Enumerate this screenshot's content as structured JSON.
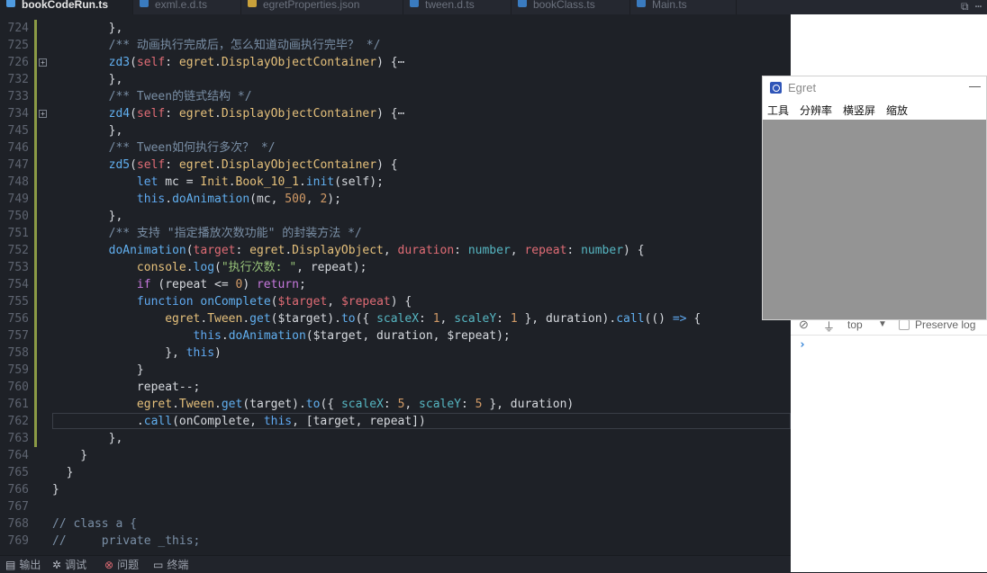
{
  "tabs": [
    {
      "label": "bookCodeRun.ts",
      "active": true,
      "kind": "ts"
    },
    {
      "label": "exml.e.d.ts",
      "active": false,
      "kind": "ts"
    },
    {
      "label": "egretProperties.json",
      "active": false,
      "kind": "json"
    },
    {
      "label": "tween.d.ts",
      "active": false,
      "kind": "ts"
    },
    {
      "label": "bookClass.ts",
      "active": false,
      "kind": "ts"
    },
    {
      "label": "Main.ts",
      "active": false,
      "kind": "ts"
    }
  ],
  "tab_tools": "⧉ ⋯",
  "code_lines": [
    {
      "n": "724",
      "fold": false,
      "tokens": [
        [
          "        },",
          "p"
        ]
      ]
    },
    {
      "n": "725",
      "fold": false,
      "tokens": [
        [
          "        ",
          "p"
        ],
        [
          "/** 动画执行完成后，怎么知道动画执行完毕？ */",
          "cm"
        ]
      ]
    },
    {
      "n": "726",
      "fold": true,
      "tokens": [
        [
          "        ",
          "p"
        ],
        [
          "zd3",
          "fn"
        ],
        [
          "(",
          "p"
        ],
        [
          "self",
          "prm"
        ],
        [
          ": ",
          "p"
        ],
        [
          "egret",
          "ty"
        ],
        [
          ".",
          "p"
        ],
        [
          "DisplayObjectContainer",
          "ty"
        ],
        [
          ") {⋯",
          "p"
        ]
      ]
    },
    {
      "n": "732",
      "fold": false,
      "tokens": [
        [
          "        },",
          "p"
        ]
      ]
    },
    {
      "n": "733",
      "fold": false,
      "tokens": [
        [
          "        ",
          "p"
        ],
        [
          "/** Tween的链式结构 */",
          "cm"
        ]
      ]
    },
    {
      "n": "734",
      "fold": true,
      "tokens": [
        [
          "        ",
          "p"
        ],
        [
          "zd4",
          "fn"
        ],
        [
          "(",
          "p"
        ],
        [
          "self",
          "prm"
        ],
        [
          ": ",
          "p"
        ],
        [
          "egret",
          "ty"
        ],
        [
          ".",
          "p"
        ],
        [
          "DisplayObjectContainer",
          "ty"
        ],
        [
          ") {⋯",
          "p"
        ]
      ]
    },
    {
      "n": "745",
      "fold": false,
      "tokens": [
        [
          "        },",
          "p"
        ]
      ]
    },
    {
      "n": "746",
      "fold": false,
      "tokens": [
        [
          "        ",
          "p"
        ],
        [
          "/** Tween如何执行多次？ */",
          "cm"
        ]
      ]
    },
    {
      "n": "747",
      "fold": false,
      "tokens": [
        [
          "        ",
          "p"
        ],
        [
          "zd5",
          "fn"
        ],
        [
          "(",
          "p"
        ],
        [
          "self",
          "prm"
        ],
        [
          ": ",
          "p"
        ],
        [
          "egret",
          "ty"
        ],
        [
          ".",
          "p"
        ],
        [
          "DisplayObjectContainer",
          "ty"
        ],
        [
          ") {",
          "p"
        ]
      ]
    },
    {
      "n": "748",
      "fold": false,
      "tokens": [
        [
          "            ",
          "p"
        ],
        [
          "let",
          "kw2"
        ],
        [
          " mc = ",
          "p"
        ],
        [
          "Init",
          "ty"
        ],
        [
          ".",
          "p"
        ],
        [
          "Book_10_1",
          "ty"
        ],
        [
          ".",
          "p"
        ],
        [
          "init",
          "fn"
        ],
        [
          "(self);",
          "p"
        ]
      ]
    },
    {
      "n": "749",
      "fold": false,
      "tokens": [
        [
          "            ",
          "p"
        ],
        [
          "this",
          "kw2"
        ],
        [
          ".",
          "p"
        ],
        [
          "doAnimation",
          "fn"
        ],
        [
          "(mc, ",
          "p"
        ],
        [
          "500",
          "num"
        ],
        [
          ", ",
          "p"
        ],
        [
          "2",
          "num"
        ],
        [
          ");",
          "p"
        ]
      ]
    },
    {
      "n": "750",
      "fold": false,
      "tokens": [
        [
          "        },",
          "p"
        ]
      ]
    },
    {
      "n": "751",
      "fold": false,
      "tokens": [
        [
          "        ",
          "p"
        ],
        [
          "/** 支持 \"指定播放次数功能\" 的封装方法 */",
          "cm"
        ]
      ]
    },
    {
      "n": "752",
      "fold": false,
      "tokens": [
        [
          "        ",
          "p"
        ],
        [
          "doAnimation",
          "fn"
        ],
        [
          "(",
          "p"
        ],
        [
          "target",
          "prm"
        ],
        [
          ": ",
          "p"
        ],
        [
          "egret",
          "ty"
        ],
        [
          ".",
          "p"
        ],
        [
          "DisplayObject",
          "ty"
        ],
        [
          ", ",
          "p"
        ],
        [
          "duration",
          "prm"
        ],
        [
          ": ",
          "p"
        ],
        [
          "number",
          "prop"
        ],
        [
          ", ",
          "p"
        ],
        [
          "repeat",
          "prm"
        ],
        [
          ": ",
          "p"
        ],
        [
          "number",
          "prop"
        ],
        [
          ") {",
          "p"
        ]
      ]
    },
    {
      "n": "753",
      "fold": false,
      "tokens": [
        [
          "            ",
          "p"
        ],
        [
          "console",
          "ty"
        ],
        [
          ".",
          "p"
        ],
        [
          "log",
          "fn"
        ],
        [
          "(",
          "p"
        ],
        [
          "\"执行次数: \"",
          "str"
        ],
        [
          ", repeat);",
          "p"
        ]
      ]
    },
    {
      "n": "754",
      "fold": false,
      "tokens": [
        [
          "            ",
          "p"
        ],
        [
          "if",
          "kw"
        ],
        [
          " (repeat <= ",
          "p"
        ],
        [
          "0",
          "num"
        ],
        [
          ") ",
          "p"
        ],
        [
          "return",
          "kw"
        ],
        [
          ";",
          "p"
        ]
      ]
    },
    {
      "n": "755",
      "fold": false,
      "tokens": [
        [
          "            ",
          "p"
        ],
        [
          "function",
          "kw2"
        ],
        [
          " ",
          "p"
        ],
        [
          "onComplete",
          "fn"
        ],
        [
          "(",
          "p"
        ],
        [
          "$target",
          "prm"
        ],
        [
          ", ",
          "p"
        ],
        [
          "$repeat",
          "prm"
        ],
        [
          ") {",
          "p"
        ]
      ]
    },
    {
      "n": "756",
      "fold": false,
      "tokens": [
        [
          "                ",
          "p"
        ],
        [
          "egret",
          "ty"
        ],
        [
          ".",
          "p"
        ],
        [
          "Tween",
          "ty"
        ],
        [
          ".",
          "p"
        ],
        [
          "get",
          "fn"
        ],
        [
          "($target).",
          "p"
        ],
        [
          "to",
          "fn"
        ],
        [
          "({ ",
          "p"
        ],
        [
          "scaleX",
          "prop"
        ],
        [
          ": ",
          "p"
        ],
        [
          "1",
          "num"
        ],
        [
          ", ",
          "p"
        ],
        [
          "scaleY",
          "prop"
        ],
        [
          ": ",
          "p"
        ],
        [
          "1",
          "num"
        ],
        [
          " }, duration).",
          "p"
        ],
        [
          "call",
          "fn"
        ],
        [
          "(() ",
          "p"
        ],
        [
          "=>",
          "kw2"
        ],
        [
          " {",
          "p"
        ]
      ]
    },
    {
      "n": "757",
      "fold": false,
      "tokens": [
        [
          "                    ",
          "p"
        ],
        [
          "this",
          "kw2"
        ],
        [
          ".",
          "p"
        ],
        [
          "doAnimation",
          "fn"
        ],
        [
          "($target, duration, $repeat);",
          "p"
        ]
      ]
    },
    {
      "n": "758",
      "fold": false,
      "tokens": [
        [
          "                }, ",
          "p"
        ],
        [
          "this",
          "kw2"
        ],
        [
          ")",
          "p"
        ]
      ]
    },
    {
      "n": "759",
      "fold": false,
      "tokens": [
        [
          "            }",
          "p"
        ]
      ]
    },
    {
      "n": "760",
      "fold": false,
      "tokens": [
        [
          "            repeat--;",
          "p"
        ]
      ]
    },
    {
      "n": "761",
      "fold": false,
      "tokens": [
        [
          "            ",
          "p"
        ],
        [
          "egret",
          "ty"
        ],
        [
          ".",
          "p"
        ],
        [
          "Tween",
          "ty"
        ],
        [
          ".",
          "p"
        ],
        [
          "get",
          "fn"
        ],
        [
          "(target).",
          "p"
        ],
        [
          "to",
          "fn"
        ],
        [
          "({ ",
          "p"
        ],
        [
          "scaleX",
          "prop"
        ],
        [
          ": ",
          "p"
        ],
        [
          "5",
          "num"
        ],
        [
          ", ",
          "p"
        ],
        [
          "scaleY",
          "prop"
        ],
        [
          ": ",
          "p"
        ],
        [
          "5",
          "num"
        ],
        [
          " }, duration)",
          "p"
        ]
      ]
    },
    {
      "n": "762",
      "fold": false,
      "current": true,
      "tokens": [
        [
          "            .",
          "p"
        ],
        [
          "call",
          "fn"
        ],
        [
          "(onComplete, ",
          "p"
        ],
        [
          "this",
          "kw2"
        ],
        [
          ", [target, repeat])",
          "p"
        ]
      ]
    },
    {
      "n": "763",
      "fold": false,
      "tokens": [
        [
          "        },",
          "p"
        ]
      ]
    },
    {
      "n": "764",
      "fold": false,
      "tokens": [
        [
          "    }",
          "p"
        ]
      ]
    },
    {
      "n": "765",
      "fold": false,
      "tokens": [
        [
          "  }",
          "p"
        ]
      ]
    },
    {
      "n": "766",
      "fold": false,
      "tokens": [
        [
          "}",
          "p"
        ]
      ]
    },
    {
      "n": "767",
      "fold": false,
      "tokens": [
        [
          "",
          "p"
        ]
      ]
    },
    {
      "n": "768",
      "fold": false,
      "tokens": [
        [
          "// class a {",
          "cm"
        ]
      ]
    },
    {
      "n": "769",
      "fold": false,
      "tokens": [
        [
          "//     private _this;",
          "cm"
        ]
      ]
    }
  ],
  "status_bar": {
    "output": "输出",
    "debug": "调试",
    "problems": "问题",
    "terminal": "终端"
  },
  "devtools": {
    "context": "top",
    "preserve_log": "Preserve log",
    "prompt": "›"
  },
  "egret_window": {
    "title": "Egret",
    "minimize": "—",
    "menu": [
      "工具",
      "分辨率",
      "横竖屏",
      "缩放"
    ]
  }
}
